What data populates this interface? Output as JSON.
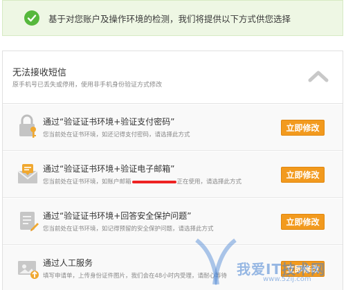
{
  "notice": {
    "message": "基于对您账户及操作环境的检测，我们将提供以下方式供您选择"
  },
  "section": {
    "title": "无法接收短信",
    "subtitle": "原手机号已丢失或停用，使用非手机身份验证方式修改"
  },
  "options": [
    {
      "icon": "lock-key-icon",
      "title": "通过“验证证书环境+验证支付密码”",
      "subtitle": "您当前处在证书环境，如还记得支付密码，请选择此方式",
      "button": "立即修改"
    },
    {
      "icon": "envelope-icon",
      "title": "通过“验证证书环境+验证电子邮箱”",
      "subtitle_pre": "您当前处在证书环境，如账户邮箱",
      "subtitle_post": "正在使用，请选择此方式",
      "button": "立即修改"
    },
    {
      "icon": "document-pen-icon",
      "title": "通过“验证证书环境+回答安全保护问题”",
      "subtitle": "您当前处在证书环境，如记得预留的安全保护问题，请选择此方式",
      "button": "立即修改"
    },
    {
      "icon": "photo-upload-icon",
      "title": "通过人工服务",
      "subtitle": "填写申请单，上传身份证件图片，我们会在48小时内受理，请耐心等待",
      "button": "立即修改"
    }
  ],
  "watermark": {
    "text": "我爱IT技术网",
    "sub": "www.52ij.com"
  },
  "colors": {
    "accent": "#f29a1e",
    "success": "#56b83c",
    "notice_bg": "#eef7e4"
  }
}
